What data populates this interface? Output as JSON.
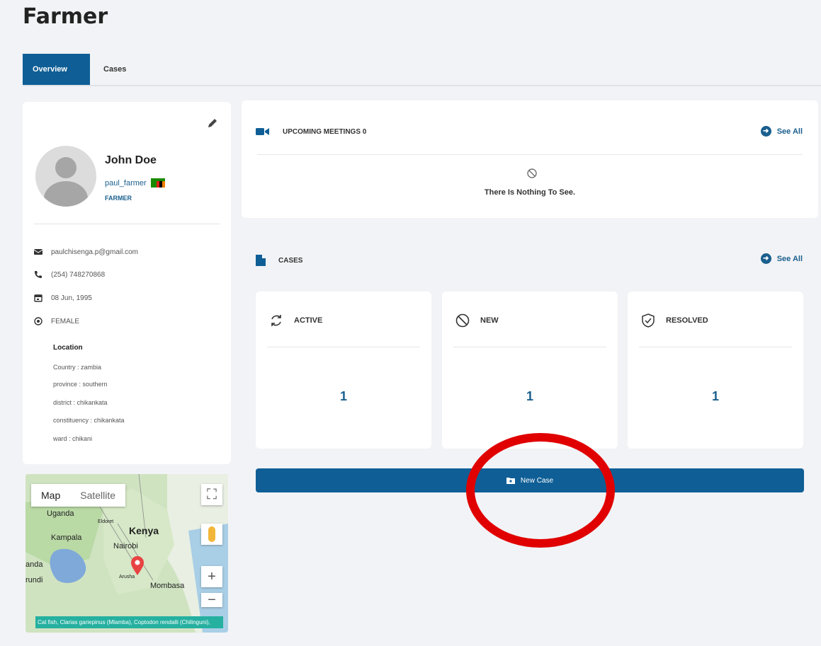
{
  "page": {
    "title": "Farmer"
  },
  "tabs": [
    {
      "label": "Overview",
      "active": true
    },
    {
      "label": "Cases",
      "active": false
    }
  ],
  "profile": {
    "name": "John Doe",
    "username": "paul_farmer",
    "role": "FARMER",
    "email": "paulchisenga.p@gmail.com",
    "phone": "(254) 748270868",
    "dob": "08 Jun, 1995",
    "gender": "FEMALE",
    "location_title": "Location",
    "location": [
      "Country : zambia",
      "province : southern",
      "district : chikankata",
      "constituency : chikankata",
      "ward : chikani"
    ]
  },
  "map": {
    "tab_map": "Map",
    "tab_satellite": "Satellite",
    "labels": [
      "Uganda",
      "Kampala",
      "Kenya",
      "Nairobi",
      "anda",
      "rundi",
      "Mombasa",
      "Eldoret",
      "Arusha"
    ],
    "footer": "Cat fish, Clarias gariepinus (Mlamba), Coptodon rendalli (Chilinguni),"
  },
  "meetings": {
    "title": "UPCOMING MEETINGS 0",
    "see_all": "See All",
    "empty": "There Is Nothing To See."
  },
  "cases": {
    "title": "CASES",
    "see_all": "See All",
    "stats": [
      {
        "label": "ACTIVE",
        "count": "1",
        "icon": "refresh-icon"
      },
      {
        "label": "NEW",
        "count": "1",
        "icon": "ban-icon"
      },
      {
        "label": "RESOLVED",
        "count": "1",
        "icon": "shield-check-icon"
      }
    ],
    "new_case_label": "New Case"
  },
  "colors": {
    "primary": "#0f5f96",
    "annotation": "#e00000"
  }
}
